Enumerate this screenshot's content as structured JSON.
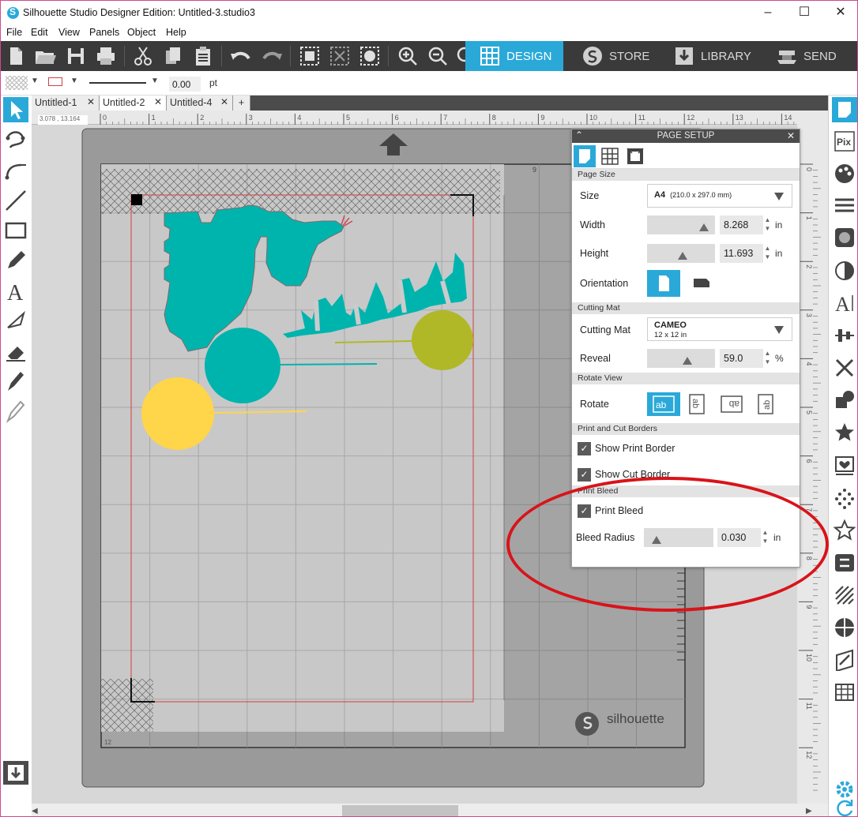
{
  "window": {
    "title": "Silhouette Studio Designer Edition: Untitled-3.studio3",
    "minimize": "–",
    "maximize": "☐",
    "close": "✕"
  },
  "menu": [
    "File",
    "Edit",
    "View",
    "Panels",
    "Object",
    "Help"
  ],
  "toolbar": {
    "nav_tabs": [
      {
        "label": "DESIGN",
        "icon": "grid-icon",
        "active": true
      },
      {
        "label": "STORE",
        "icon": "silhouette-s-icon",
        "active": false
      },
      {
        "label": "LIBRARY",
        "icon": "download-icon",
        "active": false
      },
      {
        "label": "SEND",
        "icon": "cutter-icon",
        "active": false
      }
    ]
  },
  "propbar": {
    "line_width": "0.00",
    "line_unit": "pt"
  },
  "doc_tabs": [
    {
      "label": "Untitled-1",
      "active": false
    },
    {
      "label": "Untitled-2",
      "active": true
    },
    {
      "label": "Untitled-4",
      "active": false
    }
  ],
  "canvas": {
    "coords": "3.078 , 13.164",
    "ruler_h": [
      "0",
      "1",
      "2",
      "3",
      "4",
      "5",
      "6",
      "7",
      "8",
      "9",
      "10",
      "11",
      "12",
      "13",
      "14"
    ],
    "ruler_v": [
      "0",
      "1",
      "2",
      "3",
      "4",
      "5",
      "6",
      "7",
      "8",
      "9",
      "10",
      "11",
      "12"
    ],
    "mat_brand": "silhouette",
    "mat_row_label": "9",
    "mat_col_label": "12"
  },
  "page_setup": {
    "title": "PAGE SETUP",
    "sections": {
      "page_size": "Page Size",
      "cutting_mat": "Cutting Mat",
      "rotate_view": "Rotate View",
      "print_cut_borders": "Print and Cut Borders",
      "print_bleed": "Print Bleed"
    },
    "size_label": "Size",
    "size_value": "A4",
    "size_detail": "(210.0 x 297.0 mm)",
    "width_label": "Width",
    "width_value": "8.268",
    "height_label": "Height",
    "height_value": "11.693",
    "unit_in": "in",
    "orientation_label": "Orientation",
    "cutting_mat_label": "Cutting Mat",
    "cutting_mat_value": "CAMEO",
    "cutting_mat_detail": "12 x 12 in",
    "reveal_label": "Reveal",
    "reveal_value": "59.0",
    "reveal_unit": "%",
    "rotate_label": "Rotate",
    "rotate_glyph": "ab",
    "show_print_border": "Show Print Border",
    "show_cut_border": "Show Cut Border",
    "print_bleed_label": "Print Bleed",
    "bleed_radius_label": "Bleed Radius",
    "bleed_radius_value": "0.030"
  },
  "colors": {
    "accent": "#2aa9d9",
    "teal_shape": "#00b4ae",
    "olive_balloon": "#b0b827",
    "yellow_balloon": "#ffd54a",
    "annotation_red": "#d8141a"
  }
}
